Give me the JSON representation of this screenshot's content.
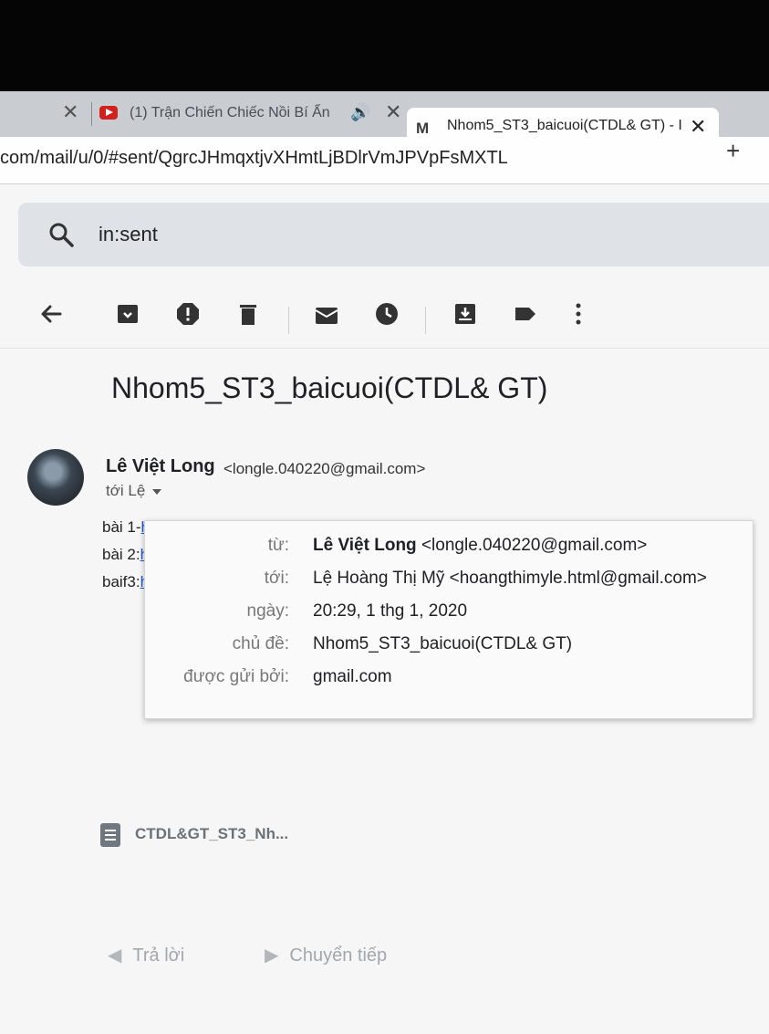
{
  "browser": {
    "tabs": [
      {
        "title": "(1) Trận Chiến Chiếc Nồi Bí Ẩn",
        "icon": "youtube-icon",
        "audio": true
      },
      {
        "title": "Nhom5_ST3_baicuoi(CTDL& GT) - I",
        "icon": "gmail-icon",
        "active": true
      }
    ],
    "url": "com/mail/u/0/#sent/QgrcJHmqxtjvXHmtLjBDlrVmJPVpFsMXTL"
  },
  "search": {
    "query": "in:sent"
  },
  "toolbar": {
    "icons": [
      "back-arrow-icon",
      "archive-icon",
      "report-spam-icon",
      "delete-icon",
      "mark-unread-icon",
      "snooze-icon",
      "move-to-icon",
      "label-icon",
      "more-icon"
    ]
  },
  "message": {
    "subject": "Nhom5_ST3_baicuoi(CTDL& GT)",
    "sender_name": "Lê Việt Long",
    "sender_email": "<longle.040220@gmail.com>",
    "to_line": "tới Lệ",
    "body_lines": [
      {
        "prefix": "bài 1-",
        "link": "h"
      },
      {
        "prefix": "bài 2:",
        "link": "h"
      },
      {
        "prefix": "baif3:",
        "link": "h"
      }
    ],
    "details": {
      "from_label": "từ:",
      "from_name": "Lê Việt Long",
      "from_email": "<longle.040220@gmail.com>",
      "to_label": "tới:",
      "to_value": "Lệ Hoàng Thị Mỹ <hoangthimyle.html@gmail.com>",
      "date_label": "ngày:",
      "date_value": "20:29, 1 thg 1, 2020",
      "subject_label": "chủ đề:",
      "subject_value": "Nhom5_ST3_baicuoi(CTDL& GT)",
      "mailedby_label": "được gửi bởi:",
      "mailedby_value": "gmail.com"
    },
    "attachment": {
      "name": "CTDL&GT_ST3_Nh..."
    },
    "actions": {
      "reply": "Trả lời",
      "forward": "Chuyển tiếp"
    }
  },
  "colors": {
    "link": "#1a55c8",
    "search_bg": "#dfe2e7",
    "youtube_red": "#d0211d"
  }
}
